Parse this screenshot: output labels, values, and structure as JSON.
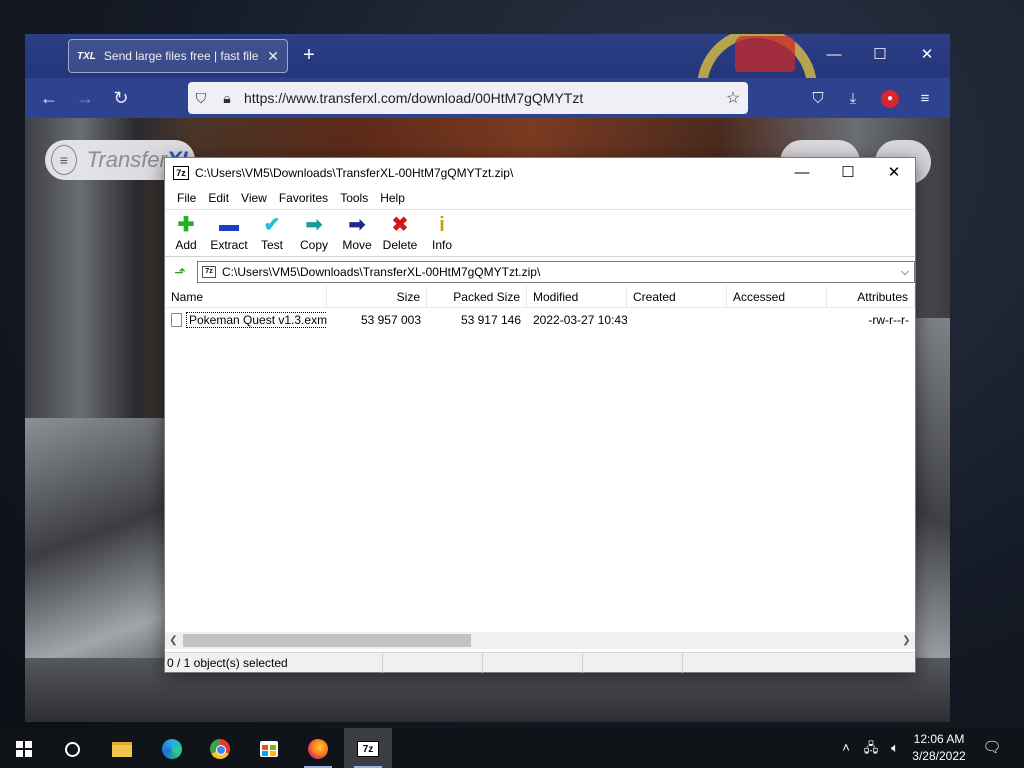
{
  "browser": {
    "tab": {
      "favicon": "TXL",
      "title": "Send large files free | fast file tra",
      "close": "✕"
    },
    "new_tab": "+",
    "window_controls": {
      "minimize": "—",
      "maximize": "☐",
      "close": "✕"
    },
    "nav": {
      "back": "←",
      "forward": "→",
      "reload": "↻"
    },
    "url": "https://www.transferxl.com/download/00HtM7gQMYTzt",
    "toolbar_icons": [
      "shield-icon",
      "downloads-icon",
      "extension-icon",
      "menu-icon"
    ]
  },
  "site": {
    "brand_prefix": "Transfer",
    "brand_suffix": "XL",
    "menu_glyph": "≡"
  },
  "zip": {
    "title": "C:\\Users\\VM5\\Downloads\\TransferXL-00HtM7gQMYTzt.zip\\",
    "app_icon": "7z",
    "menu": [
      "File",
      "Edit",
      "View",
      "Favorites",
      "Tools",
      "Help"
    ],
    "toolbar": [
      {
        "label": "Add",
        "icon": "plus-icon",
        "glyph": "✚"
      },
      {
        "label": "Extract",
        "icon": "minus-icon",
        "glyph": "▬"
      },
      {
        "label": "Test",
        "icon": "check-icon",
        "glyph": "✔"
      },
      {
        "label": "Copy",
        "icon": "copy-arrow-icon",
        "glyph": "➡"
      },
      {
        "label": "Move",
        "icon": "move-arrow-icon",
        "glyph": "➡"
      },
      {
        "label": "Delete",
        "icon": "delete-x-icon",
        "glyph": "✖"
      },
      {
        "label": "Info",
        "icon": "info-icon",
        "glyph": "i"
      }
    ],
    "address": "C:\\Users\\VM5\\Downloads\\TransferXL-00HtM7gQMYTzt.zip\\",
    "columns": [
      "Name",
      "Size",
      "Packed Size",
      "Modified",
      "Created",
      "Accessed",
      "Attributes"
    ],
    "rows": [
      {
        "name": "Pokeman Quest v1.3.exm",
        "size": "53 957 003",
        "packed": "53 917 146",
        "modified": "2022-03-27 10:43",
        "created": "",
        "accessed": "",
        "attributes": "-rw-r--r-"
      }
    ],
    "status": "0 / 1 object(s) selected"
  },
  "taskbar": {
    "time": "12:06 AM",
    "date": "3/28/2022",
    "apps": [
      "start",
      "search",
      "file-explorer",
      "edge",
      "chrome",
      "store",
      "firefox",
      "7-zip"
    ]
  }
}
